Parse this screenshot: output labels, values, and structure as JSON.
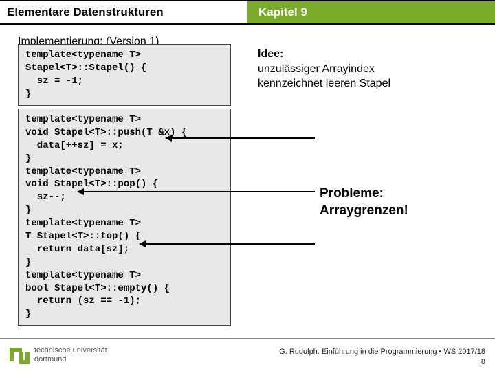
{
  "header": {
    "left": "Elementare Datenstrukturen",
    "right": "Kapitel 9"
  },
  "subtitle": "Implementierung: (Version 1)",
  "code1": "template<typename T>\nStapel<T>::Stapel() {\n  sz = -1;\n}",
  "code2": "template<typename T>\nvoid Stapel<T>::push(T &x) {\n  data[++sz] = x;\n}\ntemplate<typename T>\nvoid Stapel<T>::pop() {\n  sz--;\n}\ntemplate<typename T>\nT Stapel<T>::top() {\n  return data[sz];\n}\ntemplate<typename T>\nbool Stapel<T>::empty() {\n  return (sz == -1);\n}",
  "idea": {
    "heading": "Idee:",
    "line1": "unzulässiger Arrayindex",
    "line2": "kennzeichnet leeren Stapel"
  },
  "problems": {
    "line1": "Probleme:",
    "line2": "Arraygrenzen!"
  },
  "footer": {
    "logo_line1": "technische universität",
    "logo_line2": "dortmund",
    "credit": "G. Rudolph: Einführung in die Programmierung ▪ WS 2017/18",
    "page": "8"
  }
}
